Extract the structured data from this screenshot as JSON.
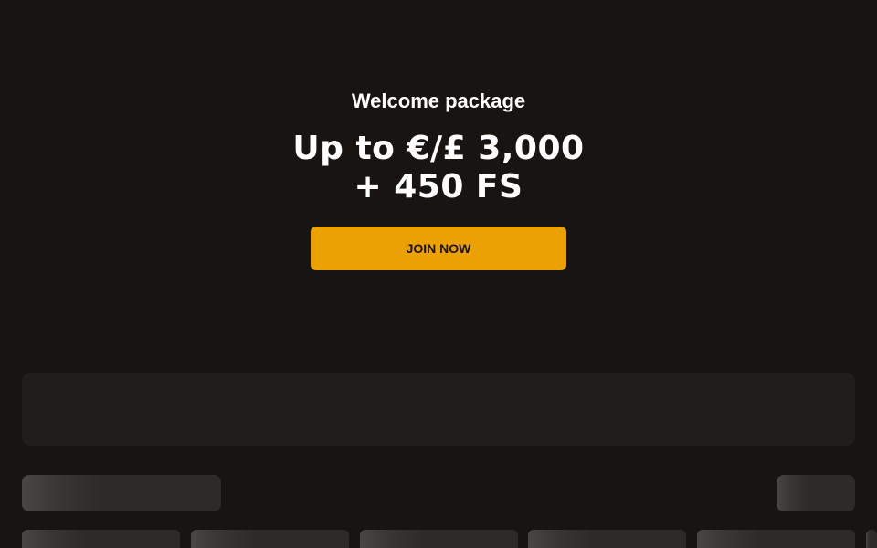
{
  "hero": {
    "kicker": "Welcome package",
    "headline_line1": "Up to €/£ 3,000",
    "headline_line2": "+ 450 FS",
    "cta_label": "JOIN NOW"
  },
  "colors": {
    "background": "#181412",
    "accent": "#eba103",
    "skeleton": "#2e2a28"
  }
}
